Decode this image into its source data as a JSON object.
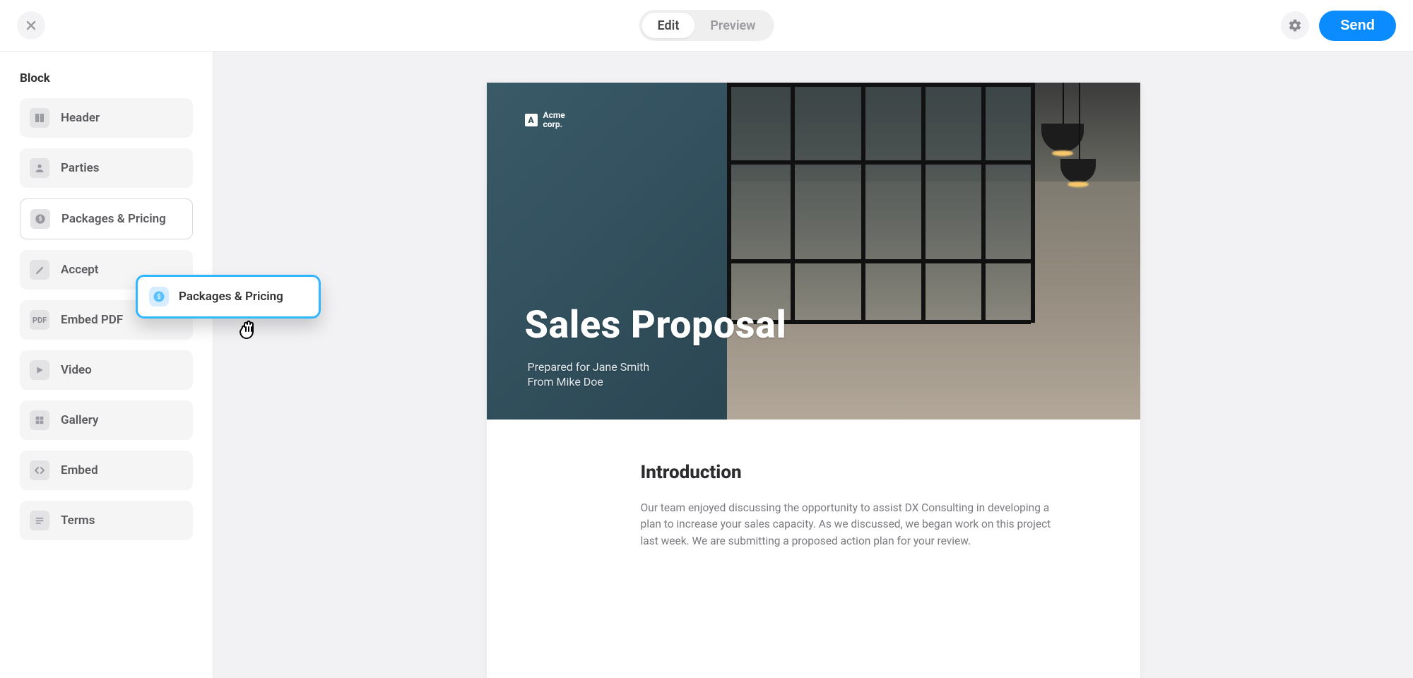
{
  "topbar": {
    "mode_edit": "Edit",
    "mode_preview": "Preview",
    "send": "Send"
  },
  "sidebar": {
    "title": "Block",
    "items": [
      {
        "label": "Header",
        "icon": "header"
      },
      {
        "label": "Parties",
        "icon": "user"
      },
      {
        "label": "Packages & Pricing",
        "icon": "dollar"
      },
      {
        "label": "Accept",
        "icon": "pencil"
      },
      {
        "label": "Embed PDF",
        "icon": "pdf"
      },
      {
        "label": "Video",
        "icon": "play"
      },
      {
        "label": "Gallery",
        "icon": "grid"
      },
      {
        "label": "Embed",
        "icon": "code"
      },
      {
        "label": "Terms",
        "icon": "lines"
      }
    ]
  },
  "dragging": {
    "label": "Packages & Pricing"
  },
  "doc": {
    "logo_text": "Acme\ncorp.",
    "title": "Sales Proposal",
    "prepared_for": "Prepared for Jane Smith",
    "from": "From Mike Doe",
    "intro_heading": "Introduction",
    "intro_body": "Our team enjoyed discussing the opportunity to assist DX Consulting in developing a plan to increase your sales capacity. As we discussed, we began work on this project last week. We are submitting a proposed action plan for your review."
  }
}
